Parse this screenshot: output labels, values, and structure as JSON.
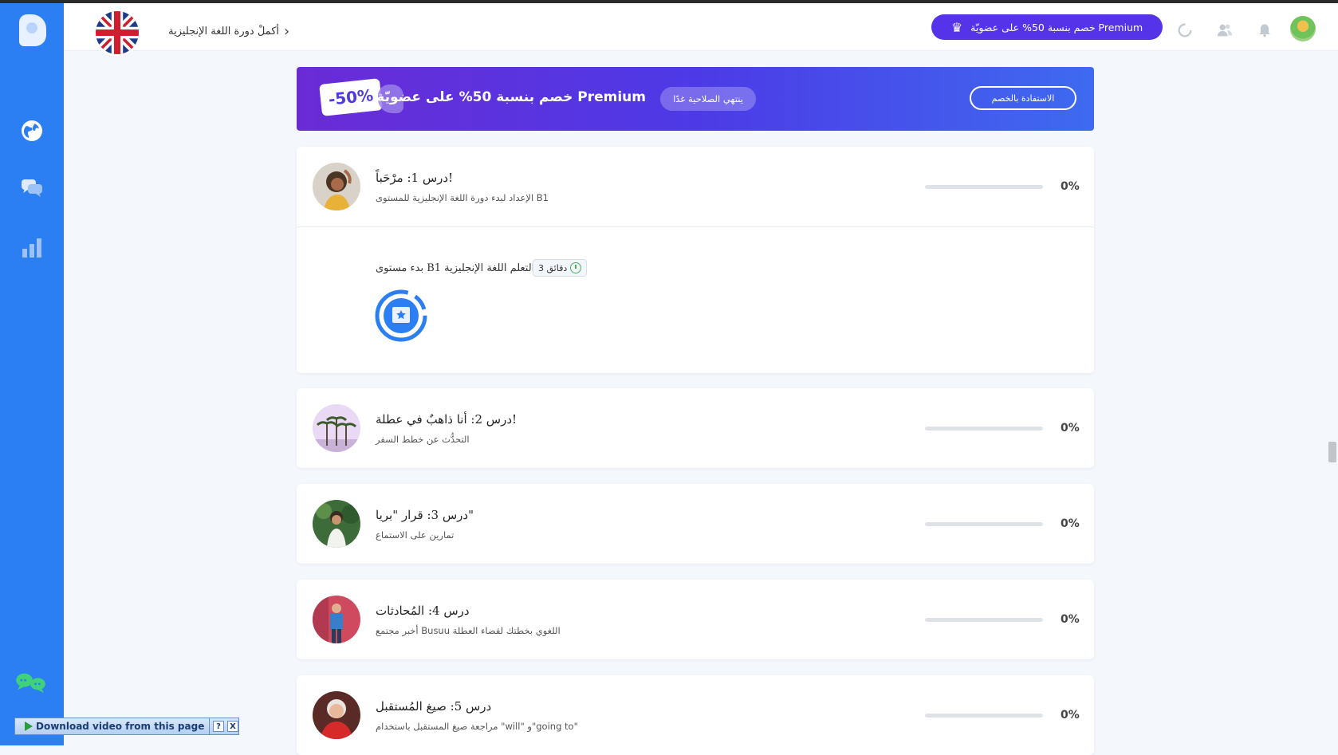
{
  "header": {
    "course_title": "أكملْ دورة اللغة الإنجليزية",
    "premium_cta": "Premium خصم بنسبة 50% على عضويّة",
    "icons": [
      "spinner-icon",
      "friends-icon",
      "bell-icon",
      "avatar"
    ]
  },
  "sidebar": {
    "items": [
      {
        "name": "globe-icon"
      },
      {
        "name": "chat-icon"
      },
      {
        "name": "stats-icon"
      },
      {
        "name": "community-icon"
      }
    ]
  },
  "banner": {
    "discount": "-50%",
    "title": "Premium خصم بنسبة 50% على عضويّة",
    "expiry": "ينتهي الصلاحية غدًا",
    "claim_button": "الاستفادة بالخصم"
  },
  "lessons": [
    {
      "title": "درس 1: مرْحَباً!",
      "subtitle": "الإعداد لبدء دورة اللغة الإنجليزية للمستوى B1",
      "progress_label": "0%",
      "progress_value": 0,
      "activity": {
        "title": "التعلم اللغة الإنجليزية B1 بدء مستوى",
        "duration": "دقائق 3"
      }
    },
    {
      "title": "درس 2: أنا ذاهبٌ في عطلة!",
      "subtitle": "التحدُّث عن خطط السفر",
      "progress_label": "0%",
      "progress_value": 0
    },
    {
      "title": "درس 3: قرار \"بريا\"",
      "subtitle": "تمارين على الاستماع",
      "progress_label": "0%",
      "progress_value": 0
    },
    {
      "title": "درس 4: المُحادثات",
      "subtitle": "أخبر مجتمع Busuu اللغوي بخطتك لقضاء العطلة",
      "progress_label": "0%",
      "progress_value": 0
    },
    {
      "title": "درس 5: صيغ المُستقبل",
      "subtitle": "مراجعة صيغ المستقبل باستخدام \"will\" و\"going to\"",
      "progress_label": "0%",
      "progress_value": 0
    }
  ],
  "download_bar": {
    "label": "Download video from this page",
    "help": "?",
    "close": "X"
  },
  "colors": {
    "sidebar": "#2b7ff2",
    "premium": "#5433e8",
    "banner_start": "#6a2bd6",
    "banner_end": "#3e6af0"
  }
}
